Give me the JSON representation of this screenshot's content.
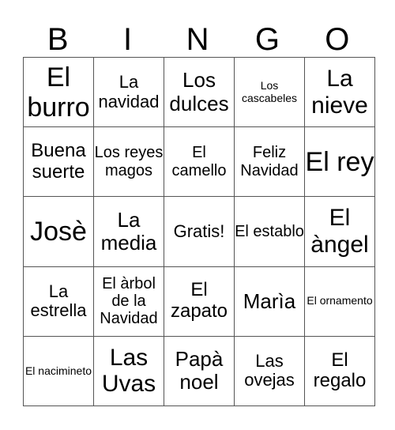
{
  "header": [
    "B",
    "I",
    "N",
    "G",
    "O"
  ],
  "rows": [
    [
      "El burro",
      "La navidad",
      "Los dulces",
      "Los cascabeles",
      "La nieve"
    ],
    [
      "Buena suerte",
      "Los reyes magos",
      "El camello",
      "Feliz Navidad",
      "El rey"
    ],
    [
      "Josè",
      "La media",
      "Gratis!",
      "El establo",
      "El àngel"
    ],
    [
      "La estrella",
      "El àrbol de la Navidad",
      "El zapato",
      "Marìa",
      "El ornamento"
    ],
    [
      "El nacimineto",
      "Las Uvas",
      "Papà noel",
      "Las ovejas",
      "El regalo"
    ]
  ]
}
